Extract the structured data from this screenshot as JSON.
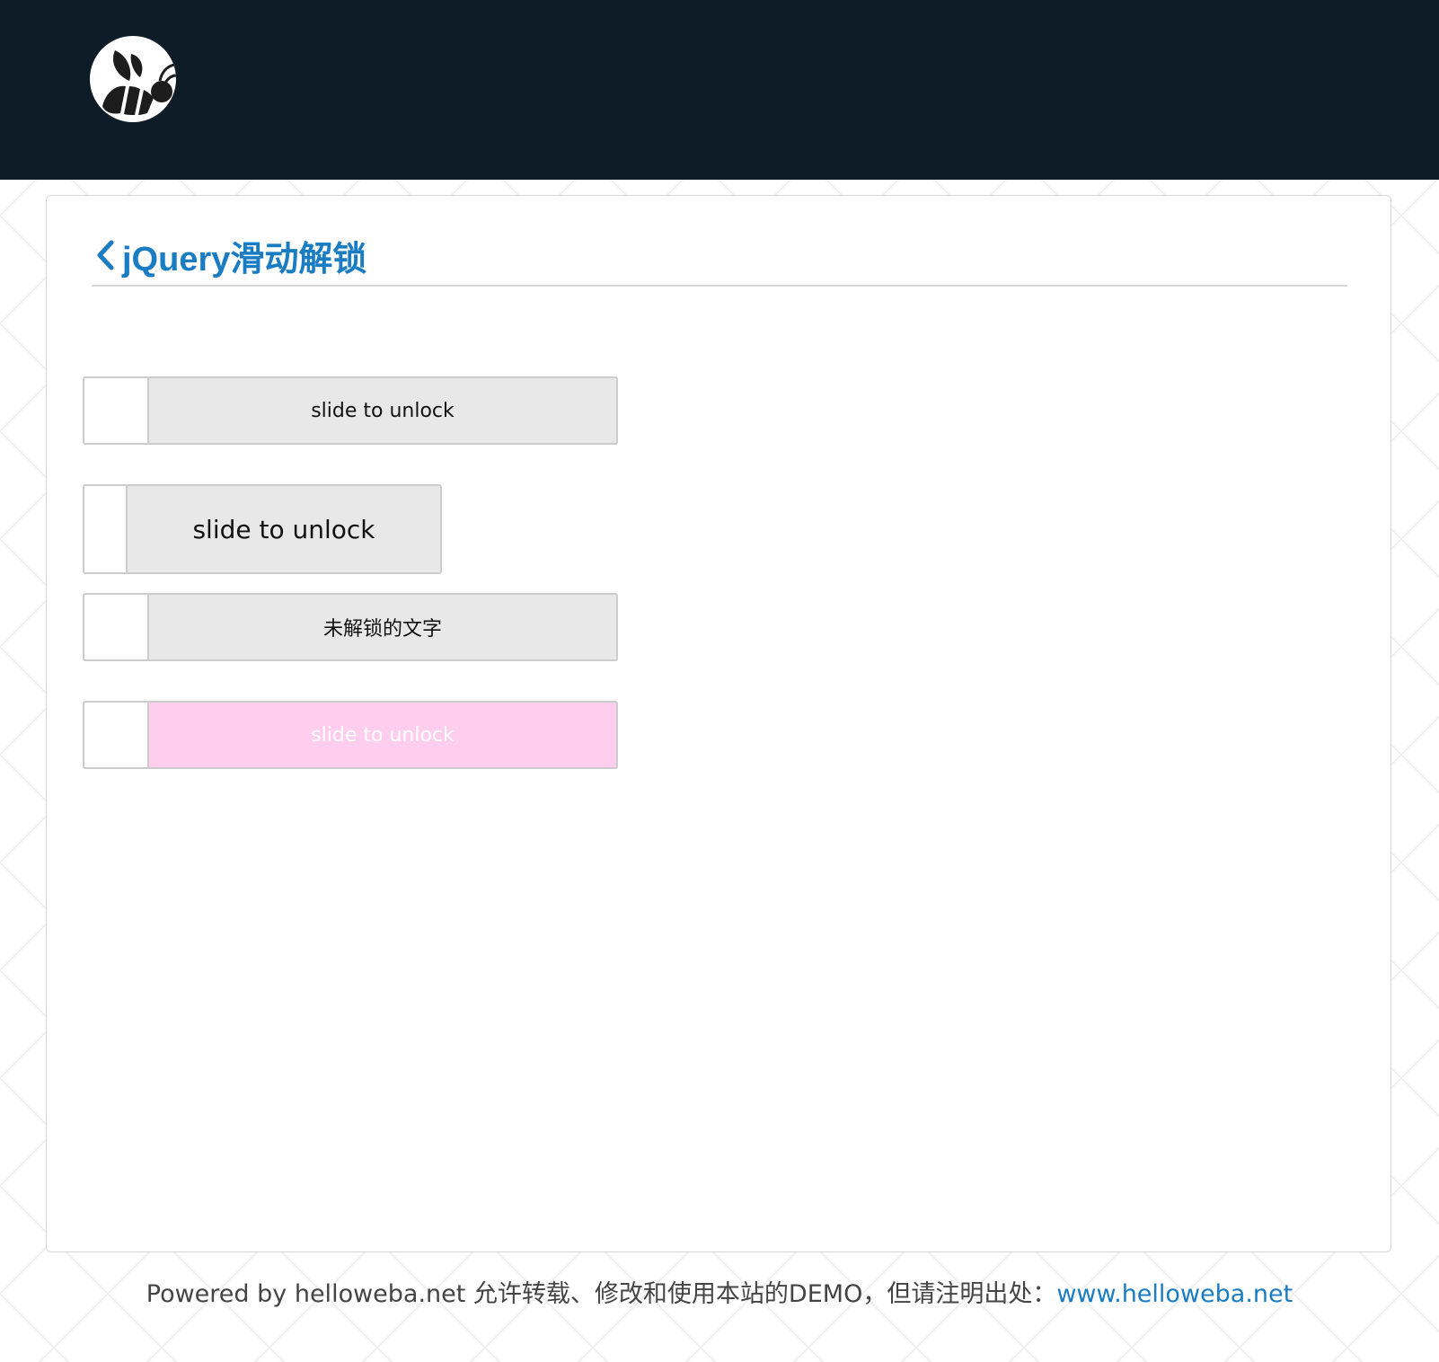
{
  "header": {
    "logo_icon": "bee-logo-icon"
  },
  "page": {
    "back_icon": "chevron-left-icon",
    "title": "jQuery滑动解锁"
  },
  "sliders": [
    {
      "label": "slide to unlock"
    },
    {
      "label": "slide to unlock"
    },
    {
      "label": "未解锁的文字"
    },
    {
      "label": "slide to unlock"
    }
  ],
  "footer": {
    "text": "Powered by helloweba.net 允许转载、修改和使用本站的DEMO，但请注明出处：",
    "link_text": "www.helloweba.net"
  },
  "colors": {
    "header_bg": "#0d1c26",
    "accent": "#1a7cc3",
    "slider_bg": "#e8e8e8",
    "slider_pink_bg": "#ffcdee"
  }
}
